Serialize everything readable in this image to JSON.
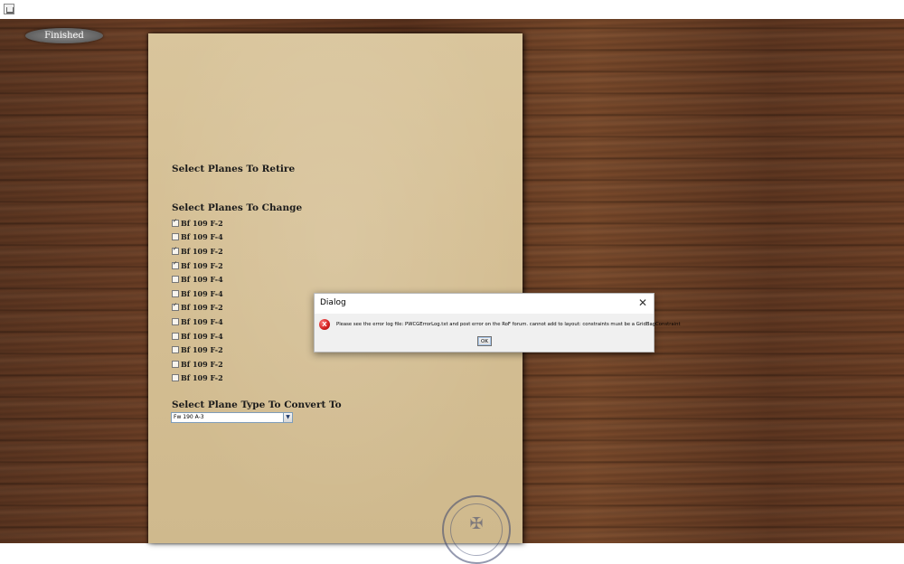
{
  "toolbar": {
    "finished_label": "Finished"
  },
  "paper": {
    "retire_title": "Select Planes To Retire",
    "change_title": "Select Planes To Change",
    "convert_title": "Select Plane Type To Convert To",
    "planes": [
      {
        "label": "Bf 109 F-2",
        "checked": true
      },
      {
        "label": "Bf 109 F-4",
        "checked": false
      },
      {
        "label": "Bf 109 F-2",
        "checked": true
      },
      {
        "label": "Bf 109 F-2",
        "checked": true
      },
      {
        "label": "Bf 109 F-4",
        "checked": false
      },
      {
        "label": "Bf 109 F-4",
        "checked": false
      },
      {
        "label": "Bf 109 F-2",
        "checked": true
      },
      {
        "label": "Bf 109 F-4",
        "checked": false
      },
      {
        "label": "Bf 109 F-4",
        "checked": false
      },
      {
        "label": "Bf 109 F-2",
        "checked": false
      },
      {
        "label": "Bf 109 F-2",
        "checked": false
      },
      {
        "label": "Bf 109 F-2",
        "checked": false
      }
    ],
    "convert_select_value": "Fw 190 A-3"
  },
  "dialog": {
    "title": "Dialog",
    "icon_glyph": "X",
    "message": "Please see the error log file: PWCGErrorLog.txt and post error on the RoF forum.  cannot add to layout: constraints must be a GridBagConstraint",
    "ok_label": "OK"
  }
}
